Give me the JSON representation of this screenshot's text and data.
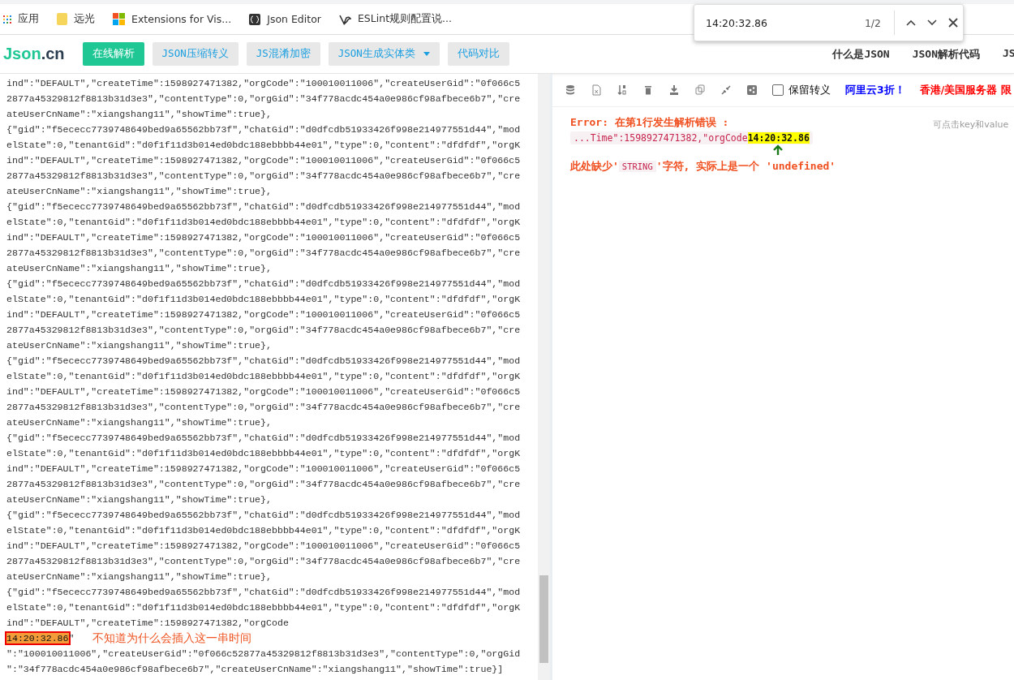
{
  "bookmarks": [
    {
      "kind": "apps",
      "label": "应用"
    },
    {
      "kind": "folder",
      "label": "远光"
    },
    {
      "kind": "windows",
      "label": "Extensions for Vis..."
    },
    {
      "kind": "braces",
      "label": "Json Editor"
    },
    {
      "kind": "bird",
      "label": "ESLint规则配置说..."
    }
  ],
  "find_bar": {
    "query": "14:20:32.86",
    "count": "1/2"
  },
  "nav": {
    "logo_main": "Json",
    "logo_suffix": ".cn",
    "buttons": [
      {
        "kind": "button",
        "label": "在线解析",
        "selected": true
      },
      {
        "kind": "button",
        "label": "JSON压缩转义",
        "selected": false
      },
      {
        "kind": "button",
        "label": "JS混淆加密",
        "selected": false
      },
      {
        "kind": "dropdown",
        "label": "JSON生成实体类",
        "selected": false
      },
      {
        "kind": "button",
        "label": "代码对比",
        "selected": false
      }
    ],
    "links": [
      "什么是JSON",
      "JSON解析代码",
      "JS"
    ]
  },
  "editor": {
    "lines": [
      {
        "kind": "code",
        "text": "ind\":\"DEFAULT\",\"createTime\":1598927471382,\"orgCode\":\"100010011006\",\"createUserGid\":\"0f066c5"
      },
      {
        "kind": "code",
        "text": "2877a45329812f8813b31d3e3\",\"contentType\":0,\"orgGid\":\"34f778acdc454a0e986cf98afbece6b7\",\"cre"
      },
      {
        "kind": "code",
        "text": "ateUserCnName\":\"xiangshang11\",\"showTime\":true},"
      },
      {
        "kind": "code",
        "text": "{\"gid\":\"f5ececc7739748649bed9a65562bb73f\",\"chatGid\":\"d0dfcdb51933426f998e214977551d44\",\"mod"
      },
      {
        "kind": "code",
        "text": "elState\":0,\"tenantGid\":\"d0f1f11d3b014ed0bdc188ebbbb44e01\",\"type\":0,\"content\":\"dfdfdf\",\"orgK"
      },
      {
        "kind": "code",
        "text": "ind\":\"DEFAULT\",\"createTime\":1598927471382,\"orgCode\":\"100010011006\",\"createUserGid\":\"0f066c5"
      },
      {
        "kind": "code",
        "text": "2877a45329812f8813b31d3e3\",\"contentType\":0,\"orgGid\":\"34f778acdc454a0e986cf98afbece6b7\",\"cre"
      },
      {
        "kind": "code",
        "text": "ateUserCnName\":\"xiangshang11\",\"showTime\":true},"
      },
      {
        "kind": "code",
        "text": "{\"gid\":\"f5ececc7739748649bed9a65562bb73f\",\"chatGid\":\"d0dfcdb51933426f998e214977551d44\",\"mod"
      },
      {
        "kind": "code",
        "text": "elState\":0,\"tenantGid\":\"d0f1f11d3b014ed0bdc188ebbbb44e01\",\"type\":0,\"content\":\"dfdfdf\",\"orgK"
      },
      {
        "kind": "code",
        "text": "ind\":\"DEFAULT\",\"createTime\":1598927471382,\"orgCode\":\"100010011006\",\"createUserGid\":\"0f066c5"
      },
      {
        "kind": "code",
        "text": "2877a45329812f8813b31d3e3\",\"contentType\":0,\"orgGid\":\"34f778acdc454a0e986cf98afbece6b7\",\"cre"
      },
      {
        "kind": "code",
        "text": "ateUserCnName\":\"xiangshang11\",\"showTime\":true},"
      },
      {
        "kind": "code",
        "text": "{\"gid\":\"f5ececc7739748649bed9a65562bb73f\",\"chatGid\":\"d0dfcdb51933426f998e214977551d44\",\"mod"
      },
      {
        "kind": "code",
        "text": "elState\":0,\"tenantGid\":\"d0f1f11d3b014ed0bdc188ebbbb44e01\",\"type\":0,\"content\":\"dfdfdf\",\"orgK"
      },
      {
        "kind": "code",
        "text": "ind\":\"DEFAULT\",\"createTime\":1598927471382,\"orgCode\":\"100010011006\",\"createUserGid\":\"0f066c5"
      },
      {
        "kind": "code",
        "text": "2877a45329812f8813b31d3e3\",\"contentType\":0,\"orgGid\":\"34f778acdc454a0e986cf98afbece6b7\",\"cre"
      },
      {
        "kind": "code",
        "text": "ateUserCnName\":\"xiangshang11\",\"showTime\":true},"
      },
      {
        "kind": "code",
        "text": "{\"gid\":\"f5ececc7739748649bed9a65562bb73f\",\"chatGid\":\"d0dfcdb51933426f998e214977551d44\",\"mod"
      },
      {
        "kind": "code",
        "text": "elState\":0,\"tenantGid\":\"d0f1f11d3b014ed0bdc188ebbbb44e01\",\"type\":0,\"content\":\"dfdfdf\",\"orgK"
      },
      {
        "kind": "code",
        "text": "ind\":\"DEFAULT\",\"createTime\":1598927471382,\"orgCode\":\"100010011006\",\"createUserGid\":\"0f066c5"
      },
      {
        "kind": "code",
        "text": "2877a45329812f8813b31d3e3\",\"contentType\":0,\"orgGid\":\"34f778acdc454a0e986cf98afbece6b7\",\"cre"
      },
      {
        "kind": "code",
        "text": "ateUserCnName\":\"xiangshang11\",\"showTime\":true},"
      },
      {
        "kind": "code",
        "text": "{\"gid\":\"f5ececc7739748649bed9a65562bb73f\",\"chatGid\":\"d0dfcdb51933426f998e214977551d44\",\"mod"
      },
      {
        "kind": "code",
        "text": "elState\":0,\"tenantGid\":\"d0f1f11d3b014ed0bdc188ebbbb44e01\",\"type\":0,\"content\":\"dfdfdf\",\"orgK"
      },
      {
        "kind": "code",
        "text": "ind\":\"DEFAULT\",\"createTime\":1598927471382,\"orgCode\":\"100010011006\",\"createUserGid\":\"0f066c5"
      },
      {
        "kind": "code",
        "text": "2877a45329812f8813b31d3e3\",\"contentType\":0,\"orgGid\":\"34f778acdc454a0e986cf98afbece6b7\",\"cre"
      },
      {
        "kind": "code",
        "text": "ateUserCnName\":\"xiangshang11\",\"showTime\":true},"
      },
      {
        "kind": "code",
        "text": "{\"gid\":\"f5ececc7739748649bed9a65562bb73f\",\"chatGid\":\"d0dfcdb51933426f998e214977551d44\",\"mod"
      },
      {
        "kind": "code",
        "text": "elState\":0,\"tenantGid\":\"d0f1f11d3b014ed0bdc188ebbbb44e01\",\"type\":0,\"content\":\"dfdfdf\",\"orgK"
      },
      {
        "kind": "code",
        "text": "ind\":\"DEFAULT\",\"createTime\":1598927471382,\"orgCode\":\"100010011006\",\"createUserGid\":\"0f066c5"
      },
      {
        "kind": "code",
        "text": "2877a45329812f8813b31d3e3\",\"contentType\":0,\"orgGid\":\"34f778acdc454a0e986cf98afbece6b7\",\"cre"
      },
      {
        "kind": "code",
        "text": "ateUserCnName\":\"xiangshang11\",\"showTime\":true},"
      },
      {
        "kind": "code",
        "text": "{\"gid\":\"f5ececc7739748649bed9a65562bb73f\",\"chatGid\":\"d0dfcdb51933426f998e214977551d44\",\"mod"
      },
      {
        "kind": "code",
        "text": "elState\":0,\"tenantGid\":\"d0f1f11d3b014ed0bdc188ebbbb44e01\",\"type\":0,\"content\":\"dfdfdf\",\"orgK"
      },
      {
        "kind": "code",
        "text": "ind\":\"DEFAULT\",\"createTime\":1598927471382,\"orgCode"
      },
      {
        "kind": "match",
        "text": "14:20:32.86",
        "after": "\"",
        "note": "不知道为什么会插入这一串时间"
      },
      {
        "kind": "code",
        "text": "\":\"100010011006\",\"createUserGid\":\"0f066c52877a45329812f8813b31d3e3\",\"contentType\":0,\"orgGid"
      },
      {
        "kind": "code",
        "text": "\":\"34f778acdc454a0e986cf98afbece6b7\",\"createUserCnName\":\"xiangshang11\",\"showTime\":true}]"
      }
    ]
  },
  "toolbar": {
    "tools": [
      {
        "kind": "database"
      },
      {
        "kind": "excel"
      },
      {
        "kind": "sort"
      },
      {
        "kind": "delete"
      },
      {
        "kind": "download"
      },
      {
        "kind": "copy"
      },
      {
        "kind": "compress"
      },
      {
        "kind": "share"
      }
    ],
    "checkbox": {
      "label": "保留转义",
      "checked": false
    },
    "promo_blue": "阿里云3折！",
    "promo_red": "香港/美国服务器 限"
  },
  "result": {
    "error_title": "Error: 在第1行发生解析错误 :",
    "context": "...Time\":1598927471382,\"orgCode",
    "context_match": "14:20:32.86",
    "message_before": "此处缺少'",
    "message_code": "STRING",
    "message_after": "'字符, 实际上是一个 'undefined'",
    "hint": "可点击key和value"
  }
}
